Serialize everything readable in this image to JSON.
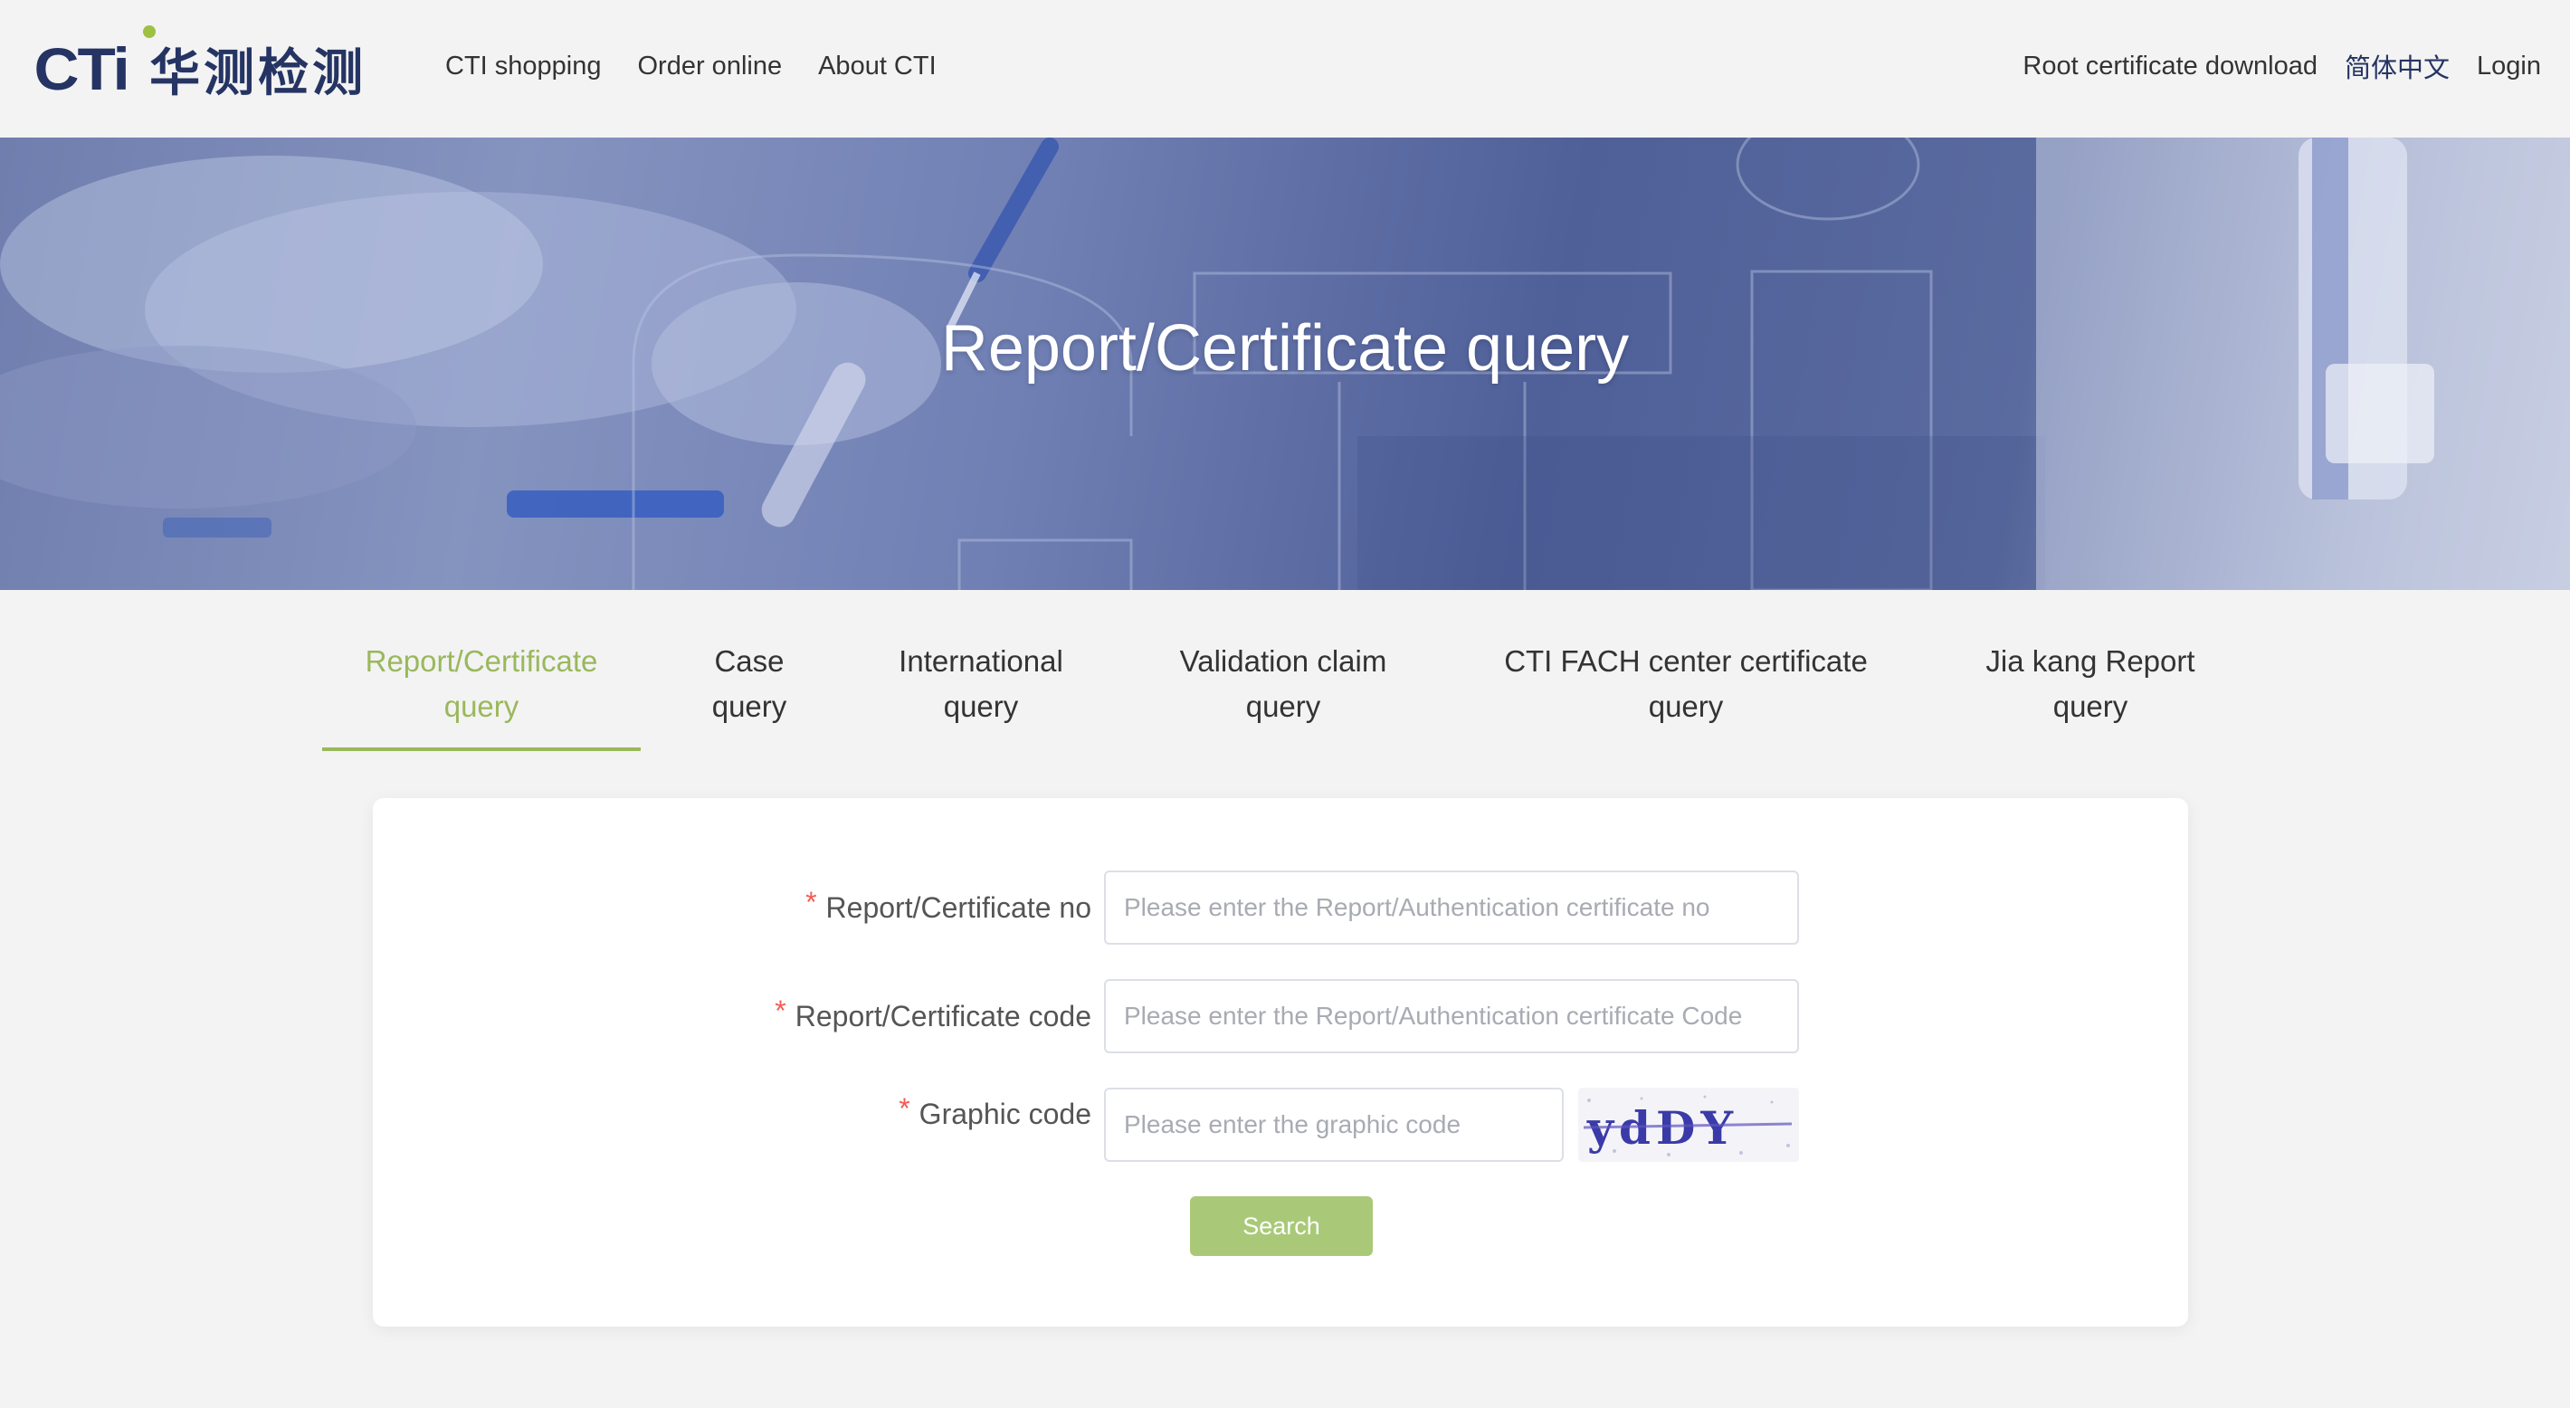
{
  "header": {
    "logo_text": "CTi",
    "logo_cn": "华测检测",
    "nav_left": [
      "CTI shopping",
      "Order online",
      "About CTI"
    ],
    "nav_right": {
      "root_cert": "Root certificate download",
      "language": "简体中文",
      "login": "Login"
    }
  },
  "banner": {
    "title": "Report/Certificate query"
  },
  "tabs": [
    {
      "line1": "Report/Certificate",
      "line2": "query",
      "active": true
    },
    {
      "line1": "Case",
      "line2": "query",
      "active": false
    },
    {
      "line1": "International",
      "line2": "query",
      "active": false
    },
    {
      "line1": "Validation claim",
      "line2": "query",
      "active": false
    },
    {
      "line1": "CTI FACH center certificate",
      "line2": "query",
      "active": false
    },
    {
      "line1": "Jia kang Report",
      "line2": "query",
      "active": false
    }
  ],
  "form": {
    "required_mark": "*",
    "fields": [
      {
        "label": "Report/Certificate no",
        "value": "",
        "placeholder": "Please enter the Report/Authentication certificate no"
      },
      {
        "label": "Report/Certificate code",
        "value": "",
        "placeholder": "Please enter the Report/Authentication certificate Code"
      },
      {
        "label": "Graphic code",
        "value": "",
        "placeholder": "Please enter the graphic code"
      }
    ],
    "captcha_text": "ydDY",
    "search_label": "Search"
  },
  "colors": {
    "brand_navy": "#253463",
    "brand_green": "#9ab85c",
    "button_green": "#a9c978",
    "required_red": "#f25c54"
  }
}
